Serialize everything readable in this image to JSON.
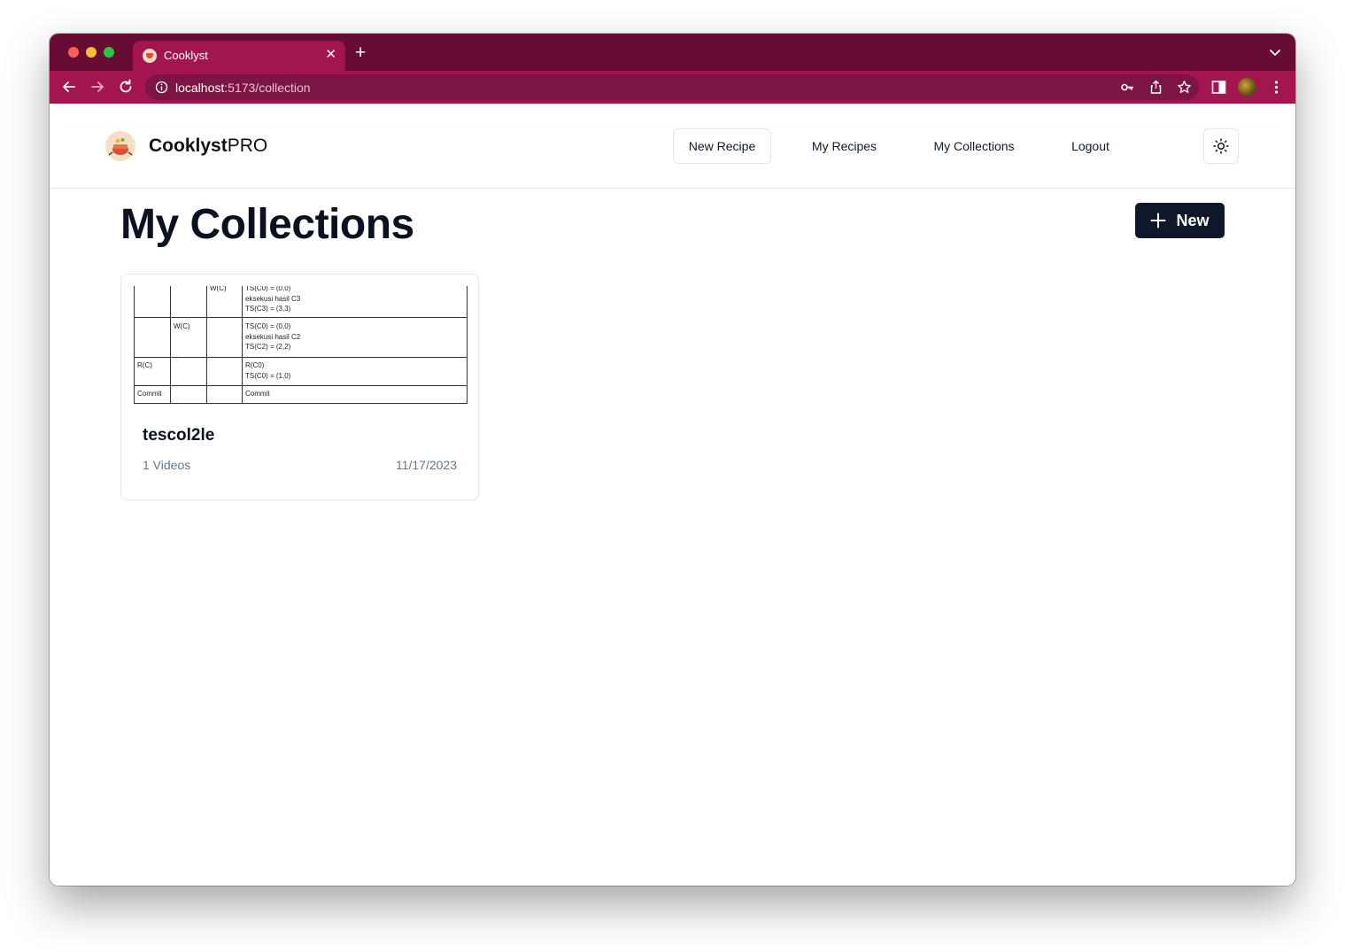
{
  "browser": {
    "tab_title": "Cooklyst",
    "tab_close": "✕",
    "new_tab": "+",
    "url_host": "localhost",
    "url_path": ":5173/collection",
    "colors": {
      "frame": "#670d35",
      "toolbar": "#a3154e",
      "omnibox": "#7d1544"
    }
  },
  "app": {
    "brand_bold": "Cooklyst",
    "brand_light": "PRO",
    "nav": {
      "new_recipe": "New Recipe",
      "my_recipes": "My Recipes",
      "my_collections": "My Collections",
      "logout": "Logout"
    },
    "theme_icon": "sun-icon"
  },
  "main": {
    "title": "My Collections",
    "new_button": "New"
  },
  "collections": [
    {
      "name": "tescol2le",
      "count": "1 Videos",
      "date": "11/17/2023",
      "thumbnail_text": {
        "r1c3": "W(C)",
        "r1c5": "TS(C0) = (0,0)\neksekusi hasil C3\nTS(C3) = (3,3)",
        "r2c2": "W(C)",
        "r2c5": "TS(C0) = (0,0)\neksekusi hasil C2\nTS(C2) = (2,2)",
        "r3c1": "R(C)",
        "r3c5": "R(C0)\nTS(C0) = (1,0)",
        "r4c1": "Commit",
        "r4c5": "Commit"
      }
    }
  ]
}
